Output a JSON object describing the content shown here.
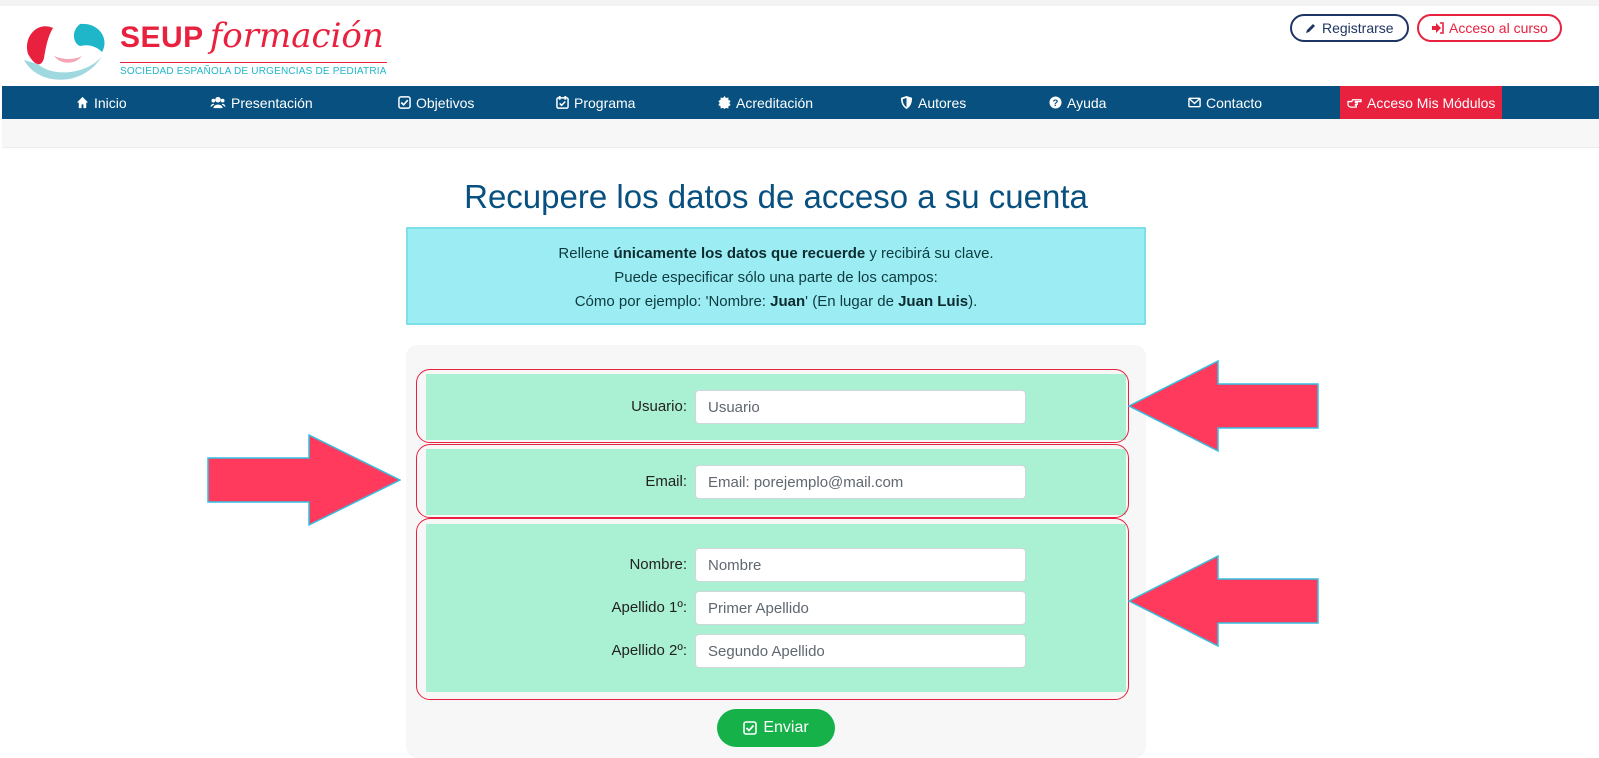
{
  "brand": {
    "name_bold": "SEUP",
    "name_script": "formación",
    "subtitle": "SOCIEDAD ESPAÑOLA DE URGENCIAS DE PEDIATRIA",
    "colors": {
      "brand_red": "#e8213f",
      "brand_teal": "#1fb6c9"
    }
  },
  "header_buttons": {
    "register": {
      "label": "Registrarse",
      "icon": "pencil-icon"
    },
    "course_access": {
      "label": "Acceso al curso",
      "icon": "sign-in-icon"
    }
  },
  "nav": {
    "color": "#07507f",
    "items": [
      {
        "label": "Inicio",
        "icon": "home-icon"
      },
      {
        "label": "Presentación",
        "icon": "users-icon"
      },
      {
        "label": "Objetivos",
        "icon": "check-square-icon"
      },
      {
        "label": "Programa",
        "icon": "calendar-check-icon"
      },
      {
        "label": "Acreditación",
        "icon": "certificate-icon"
      },
      {
        "label": "Autores",
        "icon": "shield-icon"
      },
      {
        "label": "Ayuda",
        "icon": "question-circle-icon"
      },
      {
        "label": "Contacto",
        "icon": "envelope-icon"
      },
      {
        "label": "Acceso Mis Módulos",
        "icon": "hand-pointer-icon",
        "highlight_color": "#e8213f"
      }
    ]
  },
  "page": {
    "title": "Recupere los datos de acceso a su cuenta",
    "info": {
      "line1_pre": "Rellene ",
      "line1_bold": "únicamente los datos que recuerde",
      "line1_post": " y recibirá su clave.",
      "line2": "Puede especificar sólo una parte de los campos:",
      "line3_pre": "Cómo por ejemplo: 'Nombre: ",
      "line3_bold1": "Juan",
      "line3_mid": "' (En lugar de ",
      "line3_bold2": "Juan Luis",
      "line3_post": ")."
    }
  },
  "form": {
    "usuario": {
      "label": "Usuario:",
      "placeholder": "Usuario"
    },
    "email": {
      "label": "Email:",
      "placeholder": "Email: porejemplo@mail.com"
    },
    "nombre": {
      "label": "Nombre:",
      "placeholder": "Nombre"
    },
    "apellido1": {
      "label": "Apellido 1º:",
      "placeholder": "Primer Apellido"
    },
    "apellido2": {
      "label": "Apellido 2º:",
      "placeholder": "Segundo Apellido"
    },
    "submit": {
      "label": "Enviar",
      "icon": "check-square-icon"
    },
    "group_color": "#aaf1d3",
    "annotation_arrow_color": "#ff3a5c"
  }
}
